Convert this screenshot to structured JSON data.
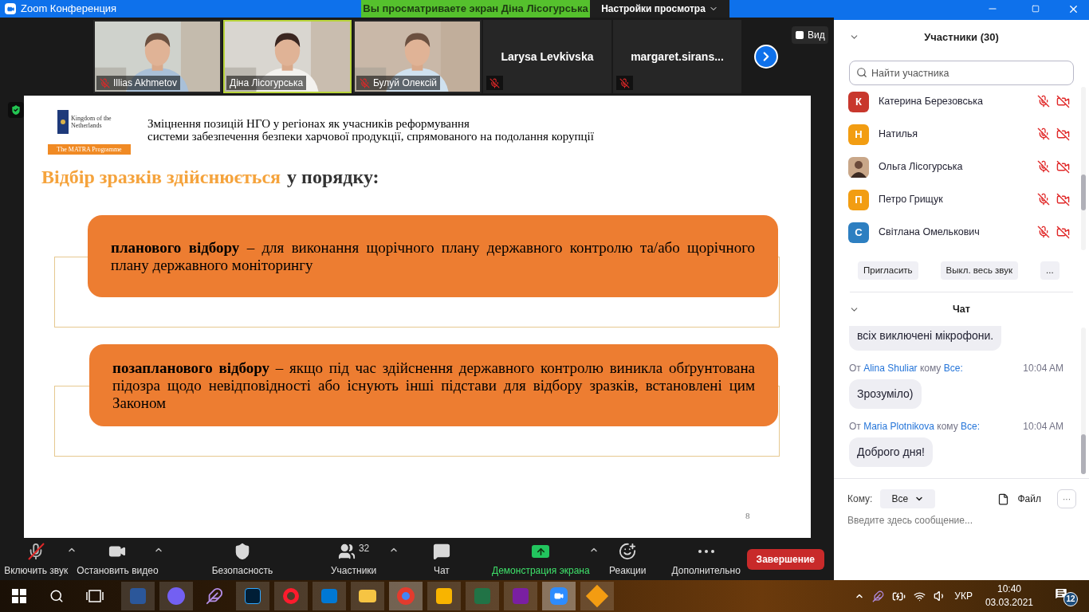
{
  "window": {
    "title": "Zoom Конференция"
  },
  "share_banner": {
    "text": "Вы просматриваете экран Діна Лісогурська",
    "settings_button": "Настройки просмотра"
  },
  "videos": [
    {
      "name": "Illias Akhmetov",
      "kind": "video",
      "muted": true,
      "speaking": false
    },
    {
      "name": "Діна Лісогурська",
      "kind": "video",
      "muted": false,
      "speaking": true
    },
    {
      "name": "Булуй Олексій",
      "kind": "video",
      "muted": true,
      "speaking": false
    },
    {
      "name": "Larysa Levkivska",
      "kind": "name",
      "muted": true,
      "speaking": false
    },
    {
      "name": "margaret.sirans...",
      "kind": "name",
      "muted": true,
      "speaking": false
    }
  ],
  "view_button": "Вид",
  "slide": {
    "logo_caption": "Kingdom of the Netherlands",
    "logo_band": "The MATRA Programme",
    "header_lines": [
      "Зміцнення позицій НГО у регіонах як учасників реформування",
      "системи забезпечення безпеки харчової продукції, спрямованого на подолання корупції"
    ],
    "heading_highlight": "Відбір зразків здійснюється",
    "heading_rest": "у порядку:",
    "boxes": [
      "**планового відбору** – для виконання щорічного плану державного контролю та/або щорічного плану державного моніторингу",
      "**позапланового відбору** – якщо під час здійснення державного контролю виникла обґрунтована підозра щодо невідповідності або існують інші підстави для відбору зразків, встановлені цим Законом"
    ],
    "page_number": "8"
  },
  "toolbar": [
    {
      "label": "Включить звук",
      "kind": "mic",
      "caret": true,
      "active": false
    },
    {
      "label": "Остановить видео",
      "kind": "video",
      "caret": true,
      "active": false
    },
    {
      "label": "Безопасность",
      "kind": "security",
      "caret": false,
      "active": false
    },
    {
      "label": "Участники",
      "kind": "participants",
      "badge": "32",
      "caret": true,
      "active": false
    },
    {
      "label": "Чат",
      "kind": "chat",
      "caret": false,
      "active": false
    },
    {
      "label": "Демонстрация экрана",
      "kind": "share",
      "caret": true,
      "active": true
    },
    {
      "label": "Реакции",
      "kind": "reactions",
      "caret": false,
      "active": false
    },
    {
      "label": "Дополнительно",
      "kind": "more",
      "caret": false,
      "active": false
    }
  ],
  "end_button": "Завершение",
  "participants": {
    "title": "Участники (30)",
    "search_placeholder": "Найти участника",
    "items": [
      {
        "initial": "К",
        "name": "Катерина Березовська",
        "kind": "initial",
        "color": "#c8372d",
        "muted": true,
        "video_off": true
      },
      {
        "initial": "Н",
        "name": "Натилья",
        "kind": "initial",
        "color": "#f29d12",
        "muted": true,
        "video_off": true
      },
      {
        "name": "Ольга Лісогурська",
        "muted": true,
        "video_off": true
      },
      {
        "initial": "П",
        "name": "Петро Грищук",
        "kind": "initial",
        "color": "#f29d12",
        "muted": true,
        "video_off": true
      },
      {
        "initial": "С",
        "name": "Світлана Омелькович",
        "kind": "initial",
        "color": "#2d7fc1",
        "muted": true,
        "video_off": true
      }
    ],
    "buttons": [
      "Пригласить",
      "Выкл. весь звук",
      "..."
    ]
  },
  "chat": {
    "title": "Чат",
    "messages": [
      {
        "text": "всіх виключені мікрофони."
      },
      {
        "from_label": "От",
        "sender": "Alina Shuliar",
        "to_label": "кому",
        "recipient": "Все:",
        "time": "10:04 AM",
        "text": "Зрозуміло)"
      },
      {
        "from_label": "От",
        "sender": "Maria Plotnikova",
        "to_label": "кому",
        "recipient": "Все:",
        "time": "10:04 AM",
        "text": "Доброго дня!"
      }
    ],
    "to_label": "Кому:",
    "recipient": "Все",
    "file_button": "Файл",
    "more_button": "···",
    "placeholder": "Введите здесь сообщение..."
  },
  "taskbar": {
    "language": "УКР",
    "time": "10:40",
    "date": "03.03.2021",
    "notifications": "12"
  }
}
